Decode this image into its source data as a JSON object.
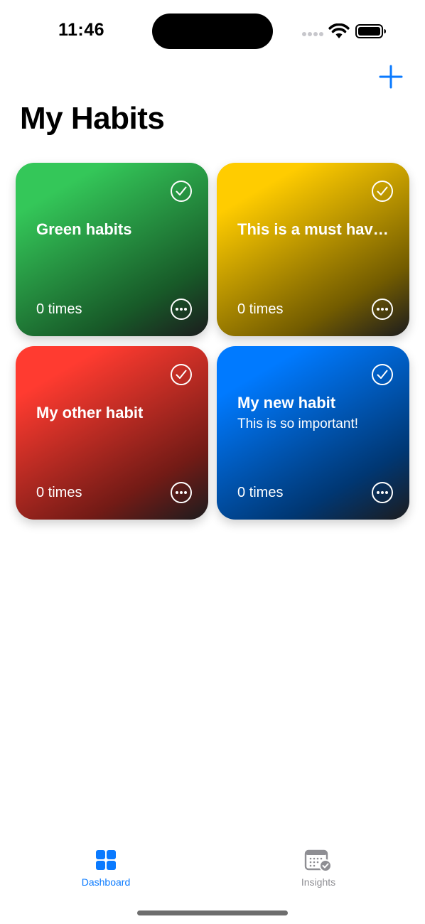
{
  "status_bar": {
    "time": "11:46"
  },
  "header": {
    "title": "My Habits",
    "add_icon": "plus-icon"
  },
  "colors": {
    "accent": "#0a7aff",
    "tab_inactive": "#8e8e93"
  },
  "habits": [
    {
      "title": "Green habits",
      "subtitle": "",
      "count": "0 times",
      "color": "#34c759"
    },
    {
      "title": "This is a must have habit",
      "subtitle": "",
      "count": "0 times",
      "color": "#ffcc00"
    },
    {
      "title": "My other habit",
      "subtitle": "",
      "count": "0 times",
      "color": "#ff3b30"
    },
    {
      "title": "My new habit",
      "subtitle": "This is so important!",
      "count": "0 times",
      "color": "#007aff"
    }
  ],
  "tabs": [
    {
      "label": "Dashboard",
      "icon": "grid-icon",
      "selected": true
    },
    {
      "label": "Insights",
      "icon": "calendar-check-icon",
      "selected": false
    }
  ]
}
